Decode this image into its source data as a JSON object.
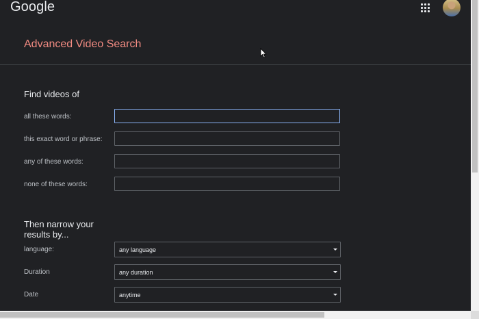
{
  "header": {
    "logo_text": "Google",
    "apps_icon": "apps-grid-icon",
    "avatar": "user-avatar"
  },
  "page_title": "Advanced Video Search",
  "find_section": {
    "title": "Find videos of",
    "fields": [
      {
        "label": "all these words:",
        "value": "",
        "focused": true
      },
      {
        "label": "this exact word or phrase:",
        "value": ""
      },
      {
        "label": "any of these words:",
        "value": ""
      },
      {
        "label": "none of these words:",
        "value": ""
      }
    ]
  },
  "narrow_section": {
    "title_line1": "Then narrow your",
    "title_line2": "results by...",
    "filters": [
      {
        "label": "language:",
        "value": "any language"
      },
      {
        "label": "Duration",
        "value": "any duration"
      },
      {
        "label": "Date",
        "value": "anytime"
      }
    ]
  },
  "colors": {
    "background": "#202124",
    "title_accent": "#f28b82",
    "focus_border": "#8ab4f8",
    "field_border": "#5f6368"
  }
}
